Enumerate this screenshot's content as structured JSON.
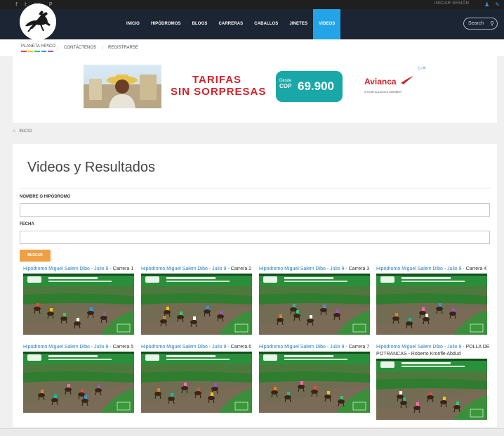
{
  "topbar": {
    "social": [
      "f",
      "t",
      "g+",
      "P"
    ],
    "login_label": "INICIAR SESIÓN",
    "icons": [
      "user-icon",
      "edit-icon"
    ]
  },
  "nav": {
    "items": [
      "INICIO",
      "HIPÓDROMOS",
      "BLOGS",
      "CARRERAS",
      "CABALLOS",
      "JINETES",
      "VIDEOS"
    ],
    "active": "VIDEOS",
    "search_placeholder": "Search"
  },
  "subnav": {
    "brand": "PLANETA HIPICO",
    "links": [
      "CONTÁCTENOS",
      "REGISTRARSE"
    ]
  },
  "ad": {
    "headline_1": "TARIFAS",
    "headline_2": "SIN SORPRESAS",
    "price_prefix_1": "Desde",
    "price_prefix_2": "COP",
    "price": "69.900",
    "brand": "Avianca",
    "brand_tagline": "A STAR ALLIANCE MEMBER"
  },
  "breadcrumb": "INICIO",
  "page": {
    "title": "Videos y Resultados",
    "field_1_label": "NOMBRE O HIPÓDROMO",
    "field_2_label": "FECHA",
    "button_label": "BUSCAR"
  },
  "videos": [
    {
      "link": "Hipódromo Miguel Salem Dibo - Julio 9 -",
      "tail": " Carrera 1"
    },
    {
      "link": "Hipódromo Miguel Salem Dibo - Julio 9 -",
      "tail": " Carrera 2"
    },
    {
      "link": "Hipódromo Miguel Salem Dibo - Julio 9 -",
      "tail": " Carrera 3"
    },
    {
      "link": "Hipódromo Miguel Salem Dibo - Julio 9 -",
      "tail": " Carrera 4"
    },
    {
      "link": "Hipódromo Miguel Salem Dibo - Julio 9 -",
      "tail": " Carrera 5"
    },
    {
      "link": "Hipódromo Miguel Salem Dibo - Julio 9 -",
      "tail": " Carrera 6"
    },
    {
      "link": "Hipódromo Miguel Salem Dibo - Julio 9 -",
      "tail": " Carrera 7"
    },
    {
      "link": "Hipódromo Miguel Salem Dibo - Julio 9 -",
      "tail": " POLLA DE POTRANCAS - Roberto Kronfle Abdud"
    }
  ],
  "colors": {
    "nav_bg": "#1c2533",
    "nav_active": "#24a4e8",
    "link": "#2a7fbf",
    "button": "#f0a044",
    "ad_red": "#d2232a",
    "ad_teal": "#1aa7a8"
  }
}
